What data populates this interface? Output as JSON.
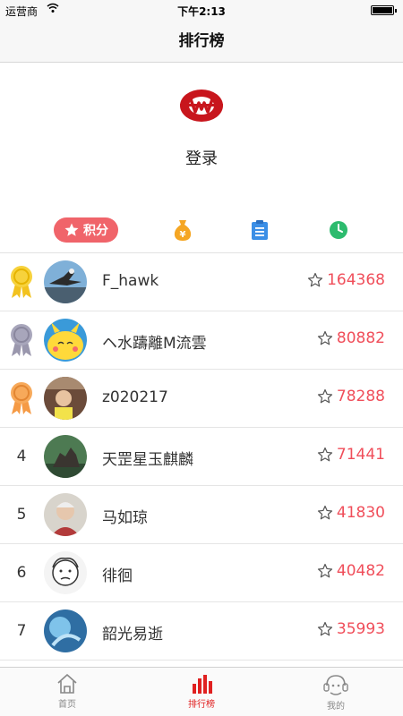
{
  "status": {
    "carrier": "运营商",
    "time": "下午2:13"
  },
  "nav": {
    "title": "排行榜"
  },
  "profile": {
    "login": "登录"
  },
  "tabs": {
    "score_label": "积分",
    "accent": "#f0646a"
  },
  "rankings": [
    {
      "rank": "1",
      "name": "F_hawk",
      "score": "164368"
    },
    {
      "rank": "2",
      "name": "ヘ水躊離M流雲",
      "score": "80882"
    },
    {
      "rank": "3",
      "name": "z020217",
      "score": "78288"
    },
    {
      "rank": "4",
      "name": "天罡星玉麒麟",
      "score": "71441"
    },
    {
      "rank": "5",
      "name": "马如琼",
      "score": "41830"
    },
    {
      "rank": "6",
      "name": "徘徊",
      "score": "40482"
    },
    {
      "rank": "7",
      "name": "韶光易逝",
      "score": "35993"
    }
  ],
  "tabbar": {
    "home": "首页",
    "rank": "排行榜",
    "me": "我的",
    "active_color": "#e02020"
  }
}
